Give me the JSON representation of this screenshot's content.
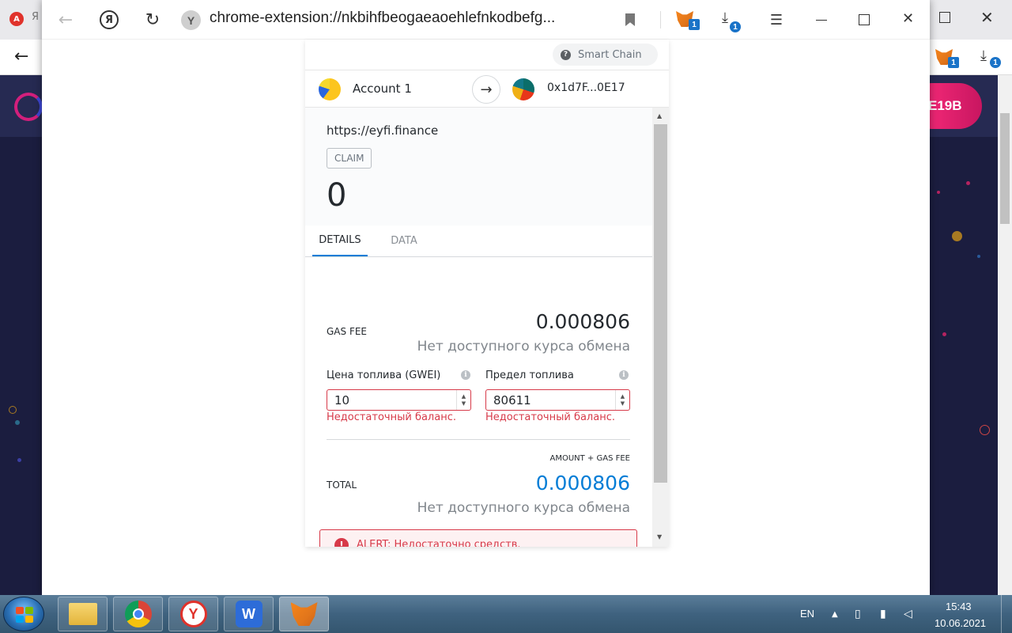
{
  "browser": {
    "popup_url": "chrome-extension://nkbihfbeogaeaoehlefnkodbefg...",
    "page_pill_text": "E19B",
    "extension_badge": "1",
    "download_badge": "1",
    "search_engine_letter": "Я"
  },
  "metamask": {
    "network": "Smart Chain",
    "from_account": "Account 1",
    "to_address": "0x1d7F...0E17",
    "origin": "https://eyfi.finance",
    "method": "CLAIM",
    "value": "0",
    "tabs": [
      {
        "label": "DETAILS",
        "active": true
      },
      {
        "label": "DATA",
        "active": false
      }
    ],
    "gas_fee": {
      "label": "GAS FEE",
      "value": "0.000806",
      "fiat": "Нет доступного курса обмена"
    },
    "gas_price": {
      "label": "Цена топлива (GWEI)",
      "value": "10",
      "error": "Недостаточный баланс."
    },
    "gas_limit": {
      "label": "Предел топлива",
      "value": "80611",
      "error": "Недостаточный баланс."
    },
    "total": {
      "caption": "AMOUNT + GAS FEE",
      "label": "TOTAL",
      "value": "0.000806",
      "fiat": "Нет доступного курса обмена"
    },
    "alert": "ALERT: Недостаточно средств.",
    "colors": {
      "accent": "#037dd6",
      "error": "#d73a49"
    }
  },
  "taskbar": {
    "language": "EN",
    "time": "15:43",
    "date": "10.06.2021",
    "apps": [
      "file-explorer",
      "chrome",
      "yandex-browser",
      "wps-writer",
      "metamask"
    ]
  }
}
